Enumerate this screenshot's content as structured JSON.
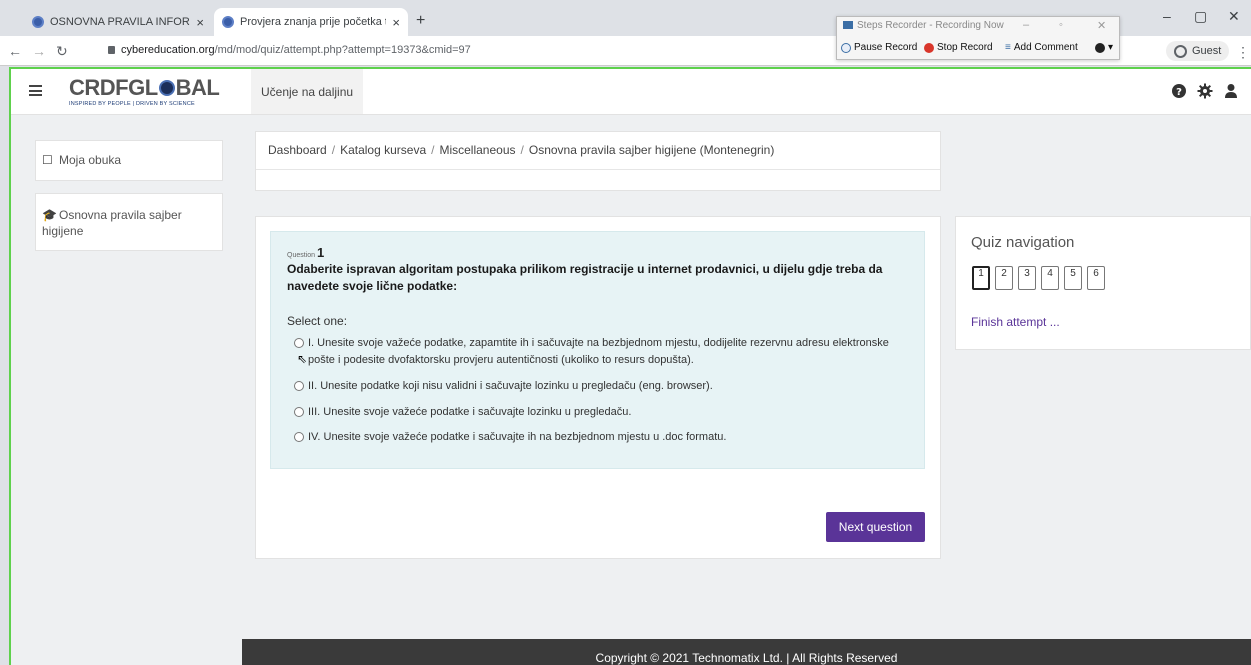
{
  "browser": {
    "tabs": [
      {
        "title": "OSNOVNA PRAVILA INFORMACIO"
      },
      {
        "title": "Provjera znanja prije početka tes"
      }
    ],
    "url": {
      "host": "cybereducation.org",
      "path": "/md/mod/quiz/attempt.php?attempt=19373&cmid=97"
    },
    "profile_label": "Guest"
  },
  "steps_recorder": {
    "title": "Steps Recorder - Recording Now",
    "pause_label": "Pause Record",
    "stop_label": "Stop Record",
    "comment_label": "Add Comment",
    "help_label": "▾"
  },
  "site": {
    "logo_main_before": "CRDFGL",
    "logo_main_after": "BAL",
    "logo_tagline": "INSPIRED BY PEOPLE | DRIVEN BY SCIENCE",
    "brand_label": "Učenje na daljinu"
  },
  "sidebar": {
    "items": [
      {
        "label": "Moja obuka"
      },
      {
        "label": "Osnovna pravila sajber higijene"
      }
    ]
  },
  "breadcrumb": {
    "items": [
      "Dashboard",
      "Katalog kurseva",
      "Miscellaneous",
      "Osnovna pravila sajber higijene (Montenegrin)"
    ],
    "separator": "/"
  },
  "question": {
    "prefix": "Question",
    "number": "1",
    "text": "Odaberite ispravan algoritam postupaka prilikom registracije u internet prodavnici, u dijelu gdje treba da navedete svoje lične podatke:",
    "select_label": "Select one:",
    "options": [
      {
        "text": "I. Unesite svoje važeće podatke, zapamtite ih i sačuvajte na bezbjednom mjestu, dodijelite rezervnu adresu elektronske pošte i podesite dvofaktorsku provjeru autentičnosti (ukoliko to resurs dopušta)."
      },
      {
        "text": "II. Unesite podatke koji nisu validni i sačuvajte lozinku u pregledaču (eng. browser)."
      },
      {
        "text": "III. Unesite svoje važeće podatke i sačuvajte lozinku u pregledaču."
      },
      {
        "text": "IV. Unesite svoje važeće podatke i sačuvajte ih na bezbjednom mjestu u .doc formatu."
      }
    ],
    "next_label": "Next question"
  },
  "quiz_nav": {
    "title": "Quiz navigation",
    "buttons": [
      "1",
      "2",
      "3",
      "4",
      "5",
      "6"
    ],
    "current": "1",
    "finish_label": "Finish attempt ..."
  },
  "footer": {
    "text": "Copyright © 2021 Technomatix Ltd. | All Rights Reserved"
  },
  "colors": {
    "accent": "#5a3498",
    "frame_highlight": "#5ed14c",
    "question_bg": "#e7f3f5",
    "footer_bg": "#3a3a3a"
  }
}
